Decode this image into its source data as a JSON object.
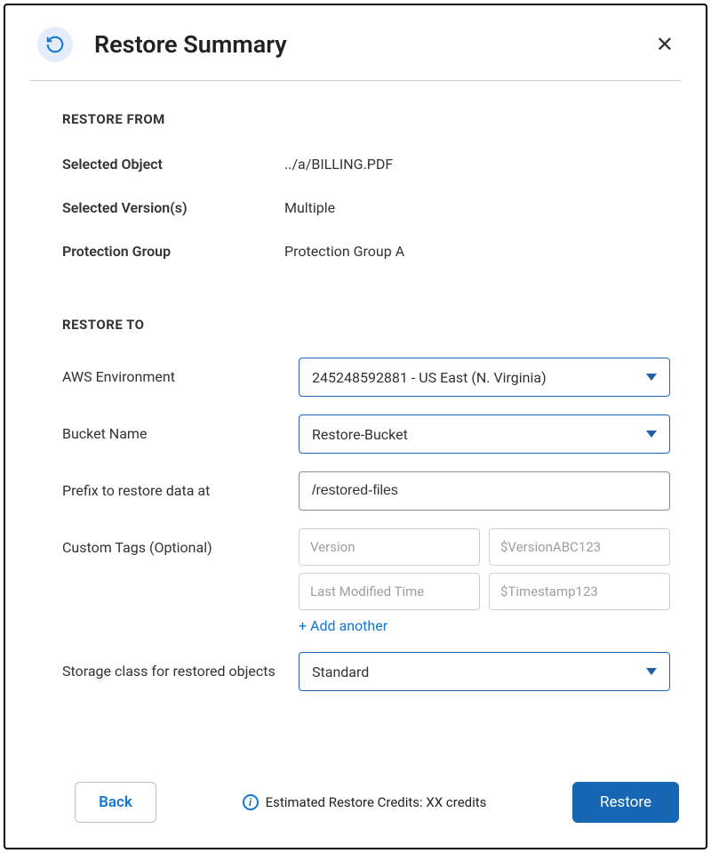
{
  "header": {
    "title": "Restore Summary"
  },
  "restore_from": {
    "title": "RESTORE FROM",
    "rows": {
      "selected_object": {
        "label": "Selected Object",
        "value": "../a/BILLING.PDF"
      },
      "selected_versions": {
        "label": "Selected Version(s)",
        "value": "Multiple"
      },
      "protection_group": {
        "label": "Protection Group",
        "value": "Protection Group A"
      }
    }
  },
  "restore_to": {
    "title": "RESTORE TO",
    "aws_env": {
      "label": "AWS Environment",
      "value": "245248592881 - US East (N. Virginia)"
    },
    "bucket": {
      "label": "Bucket Name",
      "value": "Restore-Bucket"
    },
    "prefix": {
      "label": "Prefix to restore data at",
      "value": "/restored-files"
    },
    "tags": {
      "label": "Custom Tags (Optional)",
      "rows": [
        {
          "key": "Version",
          "val": "$VersionABC123"
        },
        {
          "key": "Last Modified Time",
          "val": "$Timestamp123"
        }
      ],
      "add_another": "+ Add another"
    },
    "storage_class": {
      "label": "Storage class for restored objects",
      "value": "Standard"
    }
  },
  "footer": {
    "back": "Back",
    "credits": "Estimated Restore Credits: XX credits",
    "restore": "Restore"
  }
}
